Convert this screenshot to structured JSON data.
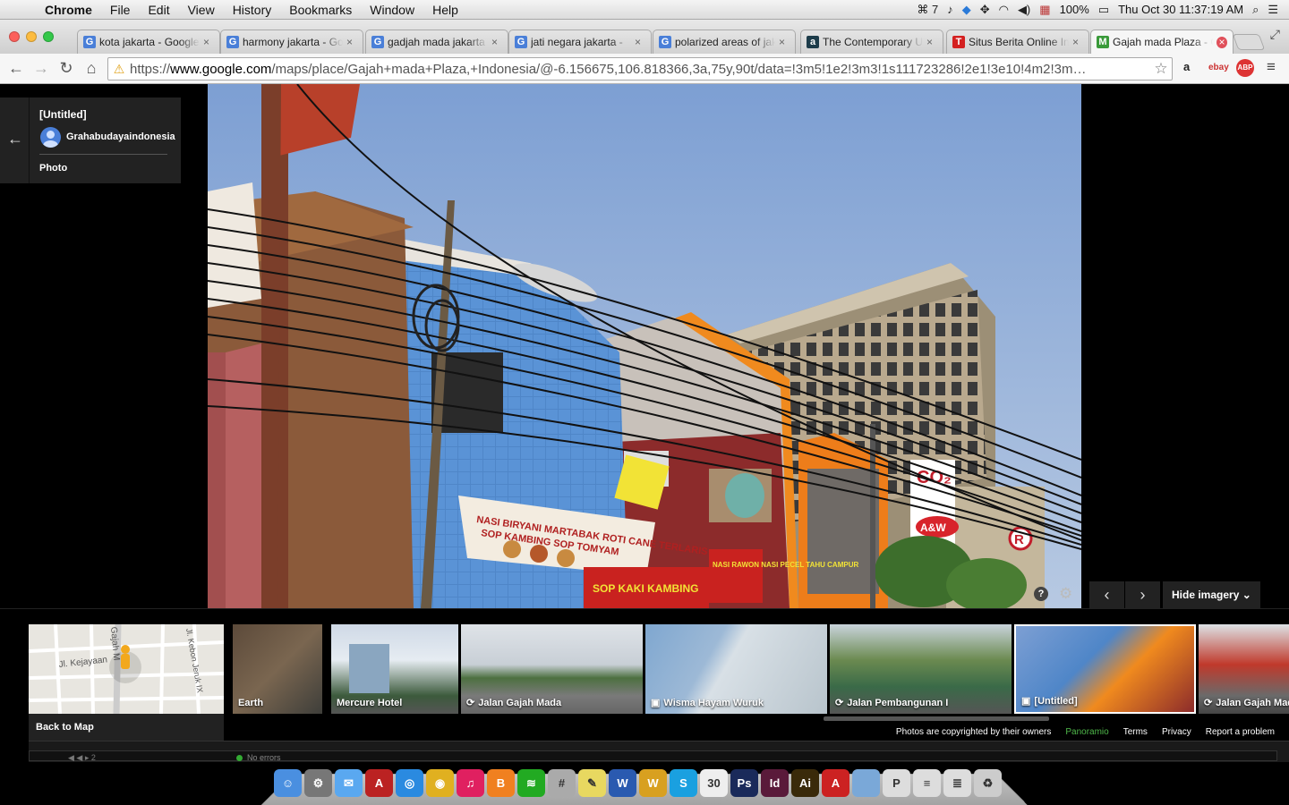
{
  "menubar": {
    "app": "Chrome",
    "items": [
      "File",
      "Edit",
      "View",
      "History",
      "Bookmarks",
      "Window",
      "Help"
    ],
    "adobe_count": "7",
    "battery": "100%",
    "clock": "Thu Oct 30  11:37:19 AM"
  },
  "tabs": [
    {
      "label": "kota jakarta - Google",
      "favicon": "G",
      "color": "#4a7fd8"
    },
    {
      "label": "harmony jakarta - Google",
      "favicon": "G",
      "color": "#4a7fd8"
    },
    {
      "label": "gadjah mada jakarta",
      "favicon": "G",
      "color": "#4a7fd8"
    },
    {
      "label": "jati negara jakarta -",
      "favicon": "G",
      "color": "#4a7fd8"
    },
    {
      "label": "polarized areas of jakarta",
      "favicon": "G",
      "color": "#4a7fd8"
    },
    {
      "label": "The Contemporary Urban",
      "favicon": "a",
      "color": "#1d3c4a"
    },
    {
      "label": "Situs Berita Online Indonesia",
      "favicon": "T",
      "color": "#d42020"
    },
    {
      "label": "Gajah mada Plaza - Google",
      "favicon": "M",
      "color": "#3a9a3a"
    }
  ],
  "toolbar": {
    "url_prefix": "https://",
    "url_host": "www.google.com",
    "url_path": "/maps/place/Gajah+mada+Plaza,+Indonesia/@-6.156675,106.818366,3a,75y,90t/data=!3m5!1e2!3m3!1s111723286!2e1!3e10!4m2!3m…",
    "ext_amazon": "a",
    "ext_ebay": "ebay",
    "ext_abp": "ABP"
  },
  "info_card": {
    "title": "[Untitled]",
    "author": "Grahabudayaindonesia",
    "kind": "Photo"
  },
  "photo_controls": {
    "prev": "‹",
    "next": "›",
    "hide_imagery": "Hide imagery",
    "help": "?"
  },
  "photo_signs": {
    "banner": "NASI BIRYANI  MARTABAK ROTI CANE TERLARIS",
    "banner2": "SOP KAMBING  SOP TOMYAM",
    "co2": "CO₂",
    "aw": "A&W",
    "r": "R",
    "nasi": "NASI RAWON NASI PECEL TAHU CAMPUR",
    "sop": "SOP KAKI KAMBING"
  },
  "filmstrip": {
    "back_to_map": "Back to Map",
    "map_street1": "Jl. Kejayaan",
    "map_street2": "Jl. Kebon Jeruk IX",
    "map_street3": "Gajah M",
    "thumbs": [
      {
        "label": "Earth",
        "icon": ""
      },
      {
        "label": "Mercure Hotel",
        "icon": ""
      },
      {
        "label": "Jalan Gajah Mada",
        "icon": "⟳"
      },
      {
        "label": "Wisma Hayam Wuruk",
        "icon": "▣"
      },
      {
        "label": "Jalan Pembangunan I",
        "icon": "⟳"
      },
      {
        "label": "[Untitled]",
        "icon": "▣"
      },
      {
        "label": "Jalan Gajah Mada",
        "icon": "⟳"
      }
    ]
  },
  "footer": {
    "copyright": "Photos are copyrighted by their owners",
    "panoramio": "Panoramio",
    "terms": "Terms",
    "privacy": "Privacy",
    "report": "Report a problem"
  },
  "status": {
    "errors": "No errors",
    "page": "2"
  },
  "dock": [
    {
      "name": "finder-icon",
      "color": "#4a8fe0",
      "glyph": "☺"
    },
    {
      "name": "system-preferences-icon",
      "color": "#777",
      "glyph": "⚙"
    },
    {
      "name": "messages-icon",
      "color": "#5aa8f0",
      "glyph": "✉"
    },
    {
      "name": "acrobat-reader-icon",
      "color": "#b22",
      "glyph": "A"
    },
    {
      "name": "safari-icon",
      "color": "#2a8ae0",
      "glyph": "◎"
    },
    {
      "name": "chrome-icon",
      "color": "#e0b020",
      "glyph": "◉"
    },
    {
      "name": "itunes-icon",
      "color": "#e02060",
      "glyph": "♫"
    },
    {
      "name": "ibooks-icon",
      "color": "#f08020",
      "glyph": "B"
    },
    {
      "name": "spotify-icon",
      "color": "#2a2",
      "glyph": "≋"
    },
    {
      "name": "calculator-icon",
      "color": "#aaa",
      "glyph": "#"
    },
    {
      "name": "stickies-icon",
      "color": "#e8d860",
      "glyph": "✎"
    },
    {
      "name": "word-icon",
      "color": "#2a5ab0",
      "glyph": "W"
    },
    {
      "name": "cyberduck-icon",
      "color": "#d8a020",
      "glyph": "W"
    },
    {
      "name": "skype-icon",
      "color": "#1aa0e0",
      "glyph": "S"
    },
    {
      "name": "calendar-icon",
      "color": "#eee",
      "glyph": "30"
    },
    {
      "name": "photoshop-icon",
      "color": "#1a2a5a",
      "glyph": "Ps"
    },
    {
      "name": "indesign-icon",
      "color": "#5a1a3a",
      "glyph": "Id"
    },
    {
      "name": "illustrator-icon",
      "color": "#3a2a0a",
      "glyph": "Ai"
    },
    {
      "name": "acrobat-icon",
      "color": "#c22",
      "glyph": "A"
    },
    {
      "name": "folder-icon",
      "color": "#7aa8d8",
      "glyph": ""
    },
    {
      "name": "pdf-document-icon",
      "color": "#ddd",
      "glyph": "P"
    },
    {
      "name": "document-icon",
      "color": "#ddd",
      "glyph": "≡"
    },
    {
      "name": "document-stack-icon",
      "color": "#ddd",
      "glyph": "≣"
    },
    {
      "name": "trash-icon",
      "color": "#ccc",
      "glyph": "♻"
    }
  ]
}
